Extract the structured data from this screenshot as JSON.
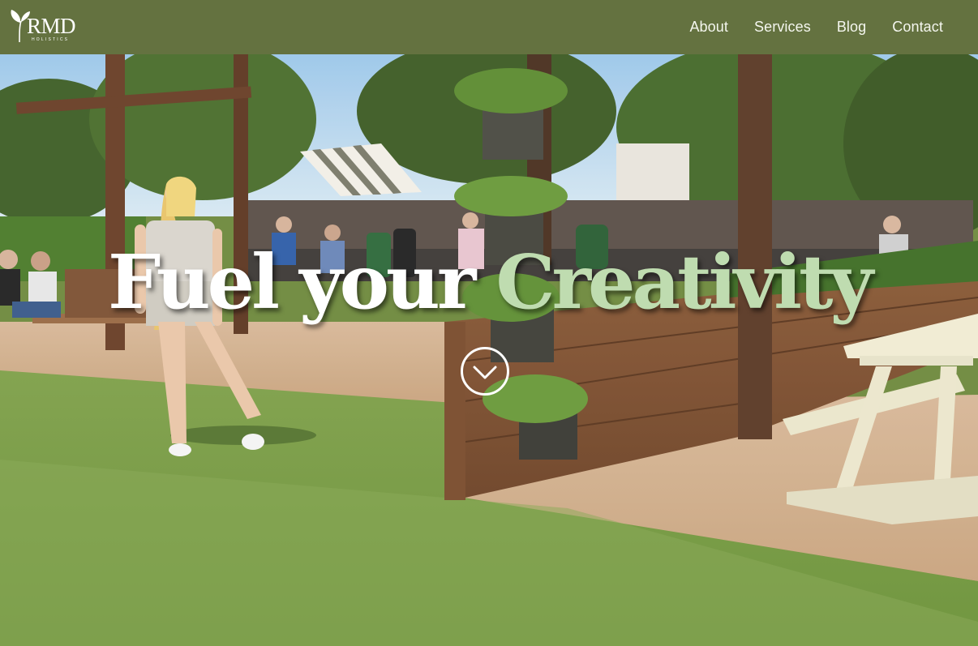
{
  "header": {
    "logo": {
      "text": "RMD",
      "subtext": "HOLISTICS"
    },
    "nav": [
      {
        "label": "About"
      },
      {
        "label": "Services"
      },
      {
        "label": "Blog"
      },
      {
        "label": "Contact"
      }
    ]
  },
  "hero": {
    "headline_part1": "Fuel your",
    "headline_part2": "Creativity",
    "scroll_icon": "chevron-down-icon"
  },
  "colors": {
    "header_bg": "#647240",
    "nav_text": "#f4f6ee",
    "headline_white": "#ffffff",
    "headline_accent": "#bfdcb0"
  }
}
